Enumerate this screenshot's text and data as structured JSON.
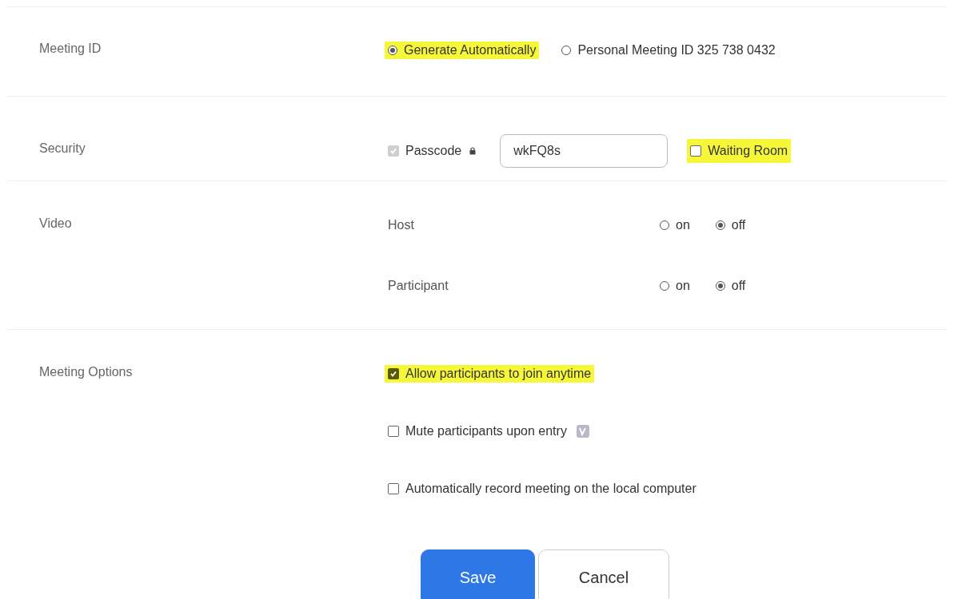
{
  "meeting_id": {
    "label": "Meeting ID",
    "options": [
      {
        "label": "Generate Automatically",
        "selected": true,
        "highlighted": true
      },
      {
        "label": "Personal Meeting ID 325 738 0432",
        "selected": false,
        "highlighted": false
      }
    ]
  },
  "security": {
    "label": "Security",
    "passcode": {
      "label": "Passcode",
      "checked": true,
      "disabled": true,
      "value": "wkFQ8s"
    },
    "waiting_room": {
      "label": "Waiting Room",
      "checked": false,
      "highlighted": true
    }
  },
  "video": {
    "label": "Video",
    "rows": [
      {
        "label": "Host",
        "options": [
          {
            "label": "on",
            "selected": false
          },
          {
            "label": "off",
            "selected": true
          }
        ]
      },
      {
        "label": "Participant",
        "options": [
          {
            "label": "on",
            "selected": false
          },
          {
            "label": "off",
            "selected": true
          }
        ]
      }
    ]
  },
  "meeting_options": {
    "label": "Meeting Options",
    "items": [
      {
        "label": "Allow participants to join anytime",
        "checked": true,
        "highlighted": true,
        "info": false
      },
      {
        "label": "Mute participants upon entry",
        "checked": false,
        "highlighted": false,
        "info": true
      },
      {
        "label": "Automatically record meeting on the local computer",
        "checked": false,
        "highlighted": false,
        "info": false
      }
    ]
  },
  "buttons": [
    {
      "label": "Save",
      "kind": "primary"
    },
    {
      "label": "Cancel",
      "kind": "secondary"
    }
  ]
}
